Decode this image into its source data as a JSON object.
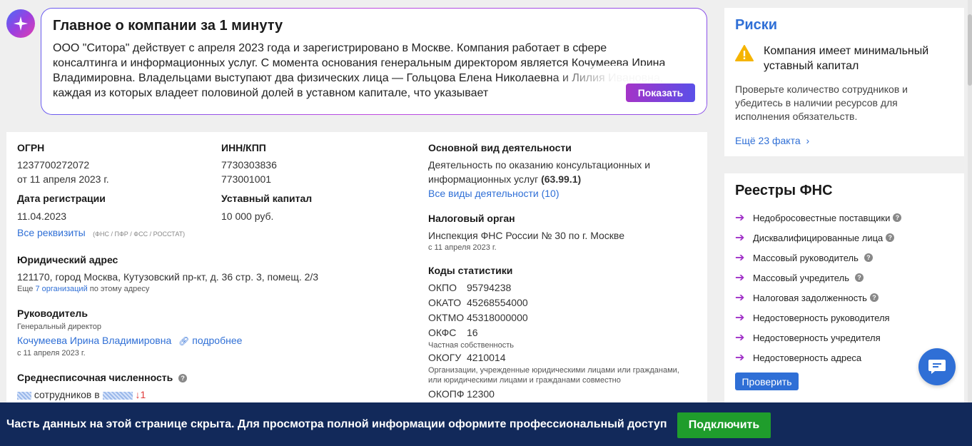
{
  "summary": {
    "title": "Главное о компании за 1 минуту",
    "text": "ООО \"Ситора\" действует с апреля 2023 года и зарегистрировано в Москве. Компания работает в сфере консалтинга и информационных услуг. С момента основания генеральным директором является Кочумеева Ирина Владимировна. Владельцами выступают два физических лица — Гольцова Елена Николаевна и Лилия Ивановна, каждая из которых владеет половиной долей в уставном капитале, что указывает",
    "show_button": "Показать"
  },
  "requisites": {
    "ogrn_label": "ОГРН",
    "ogrn_value": "1237700272072",
    "ogrn_date": "от 11 апреля 2023 г.",
    "inn_label": "ИНН/КПП",
    "inn_value": "7730303836",
    "kpp_value": "773001001",
    "reg_date_label": "Дата регистрации",
    "reg_date_value": "11.04.2023",
    "capital_label": "Уставный капитал",
    "capital_value": "10 000 руб.",
    "all_requisites_link": "Все реквизиты",
    "all_requisites_note": "(ФНС / ПФР / ФСС / РОССТАТ)",
    "address_label": "Юридический адрес",
    "address_value": "121170, город Москва, Кутузовский пр-кт, д. 36 стр. 3, помещ. 2/3",
    "address_more_prefix": "Еще",
    "address_more_link": "7 организаций",
    "address_more_suffix": "по этому адресу",
    "director_label": "Руководитель",
    "director_role": "Генеральный директор",
    "director_name": "Кочумеева Ирина Владимировна",
    "director_more": "подробнее",
    "director_date": "с 11 апреля 2023 г.",
    "headcount_label": "Среднесписочная численность",
    "headcount_text": "сотрудников в",
    "headcount_change": "↓1"
  },
  "activity": {
    "main_label": "Основной вид деятельности",
    "main_value": "Деятельность по оказанию консультационных и информационных услуг",
    "main_code": "(63.99.1)",
    "all_link": "Все виды деятельности (10)",
    "tax_label": "Налоговый орган",
    "tax_value": "Инспекция ФНС России № 30 по г. Москве",
    "tax_date": "с 11 апреля 2023 г.",
    "stats_label": "Коды статистики",
    "okpo_k": "ОКПО",
    "okpo_v": "95794238",
    "okato_k": "ОКАТО",
    "okato_v": "45268554000",
    "oktmo_k": "ОКТМО",
    "oktmo_v": "45318000000",
    "okfs_k": "ОКФС",
    "okfs_v": "16",
    "okfs_note": "Частная собственность",
    "okogu_k": "ОКОГУ",
    "okogu_v": "4210014",
    "okogu_note": "Организации, учрежденные юридическими лицами или гражданами, или юридическими лицами и гражданами совместно",
    "okopf_k": "ОКОПФ",
    "okopf_v": "12300"
  },
  "risks": {
    "title": "Риски",
    "warning": "Компания имеет минимальный уставный капитал",
    "description": "Проверьте количество сотрудников и убедитесь в наличии ресурсов для исполнения обязательств.",
    "more": "Ещё 23 факта"
  },
  "fns": {
    "title": "Реестры ФНС",
    "items": [
      {
        "label": "Недобросовестные поставщики"
      },
      {
        "label": "Дисквалифицированные лица"
      },
      {
        "label": "Массовый руководитель"
      },
      {
        "label": "Массовый учредитель"
      },
      {
        "label": "Налоговая задолженность"
      },
      {
        "label": "Недостоверность руководителя"
      },
      {
        "label": "Недостоверность учредителя"
      },
      {
        "label": "Недостоверность адреса"
      }
    ],
    "check_button": "Проверить"
  },
  "banner": {
    "text": "Часть данных на этой странице скрыта. Для просмотра полной информации оформите профессиональный доступ",
    "button": "Подключить"
  },
  "colors": {
    "accent": "#2f6fd6",
    "banner_bg": "#12295a",
    "banner_button": "#1f9d2c",
    "warning": "#f5b400"
  }
}
